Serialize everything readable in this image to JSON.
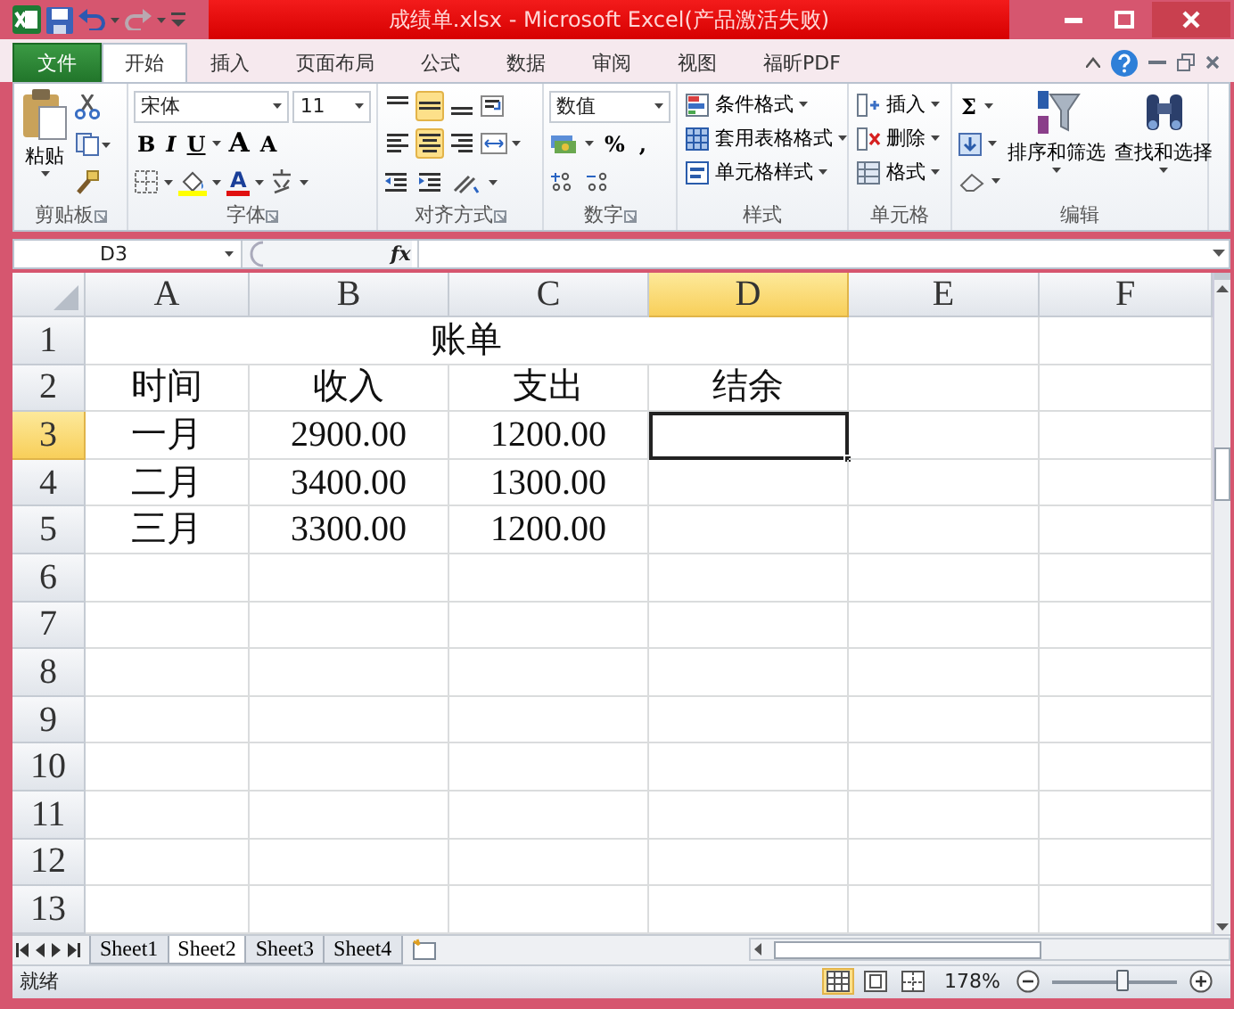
{
  "window": {
    "title": "成绩单.xlsx - Microsoft Excel(产品激活失败)"
  },
  "ribbon_tabs": [
    {
      "label": "文件",
      "kind": "file",
      "selected": false
    },
    {
      "label": "开始",
      "kind": "tab",
      "selected": true
    },
    {
      "label": "插入",
      "kind": "tab",
      "selected": false
    },
    {
      "label": "页面布局",
      "kind": "tab",
      "selected": false
    },
    {
      "label": "公式",
      "kind": "tab",
      "selected": false
    },
    {
      "label": "数据",
      "kind": "tab",
      "selected": false
    },
    {
      "label": "审阅",
      "kind": "tab",
      "selected": false
    },
    {
      "label": "视图",
      "kind": "tab",
      "selected": false
    },
    {
      "label": "福昕PDF",
      "kind": "tab",
      "selected": false
    }
  ],
  "ribbon": {
    "groups": [
      {
        "kind": "clipboard",
        "label": "剪贴板",
        "paste": "粘贴"
      },
      {
        "kind": "font",
        "label": "字体",
        "font": "宋体",
        "size": "11",
        "buttons": [
          "B",
          "I",
          "U",
          "A",
          "A"
        ],
        "font_color": "A"
      },
      {
        "kind": "alignment",
        "label": "对齐方式",
        "toggles": [
          {
            "selected": false
          },
          {
            "selected": true
          },
          {
            "selected": false
          },
          {
            "selected": false
          },
          {
            "selected": true
          },
          {
            "selected": false
          }
        ]
      },
      {
        "kind": "number",
        "label": "数字",
        "format": "数值",
        "buttons": [
          "%",
          ","
        ]
      },
      {
        "kind": "list",
        "label": "样式",
        "items": [
          "条件格式",
          "套用表格格式",
          "单元格样式"
        ]
      },
      {
        "kind": "list",
        "label": "单元格",
        "items": [
          "插入",
          "删除",
          "格式"
        ]
      },
      {
        "kind": "editing",
        "label": "编辑",
        "sum": "Σ",
        "items": [
          "排序和筛选",
          "查找和选择"
        ]
      }
    ]
  },
  "formula_bar": {
    "name_box": "D3",
    "function_label": "fx"
  },
  "sheet": {
    "columns": [
      {
        "label": "A",
        "selected": false
      },
      {
        "label": "B",
        "selected": false
      },
      {
        "label": "C",
        "selected": false
      },
      {
        "label": "D",
        "selected": true
      },
      {
        "label": "E",
        "selected": false
      },
      {
        "label": "F",
        "selected": false
      }
    ],
    "rows": [
      {
        "label": "1",
        "selected": false,
        "kind": "merged",
        "cells": [
          "账单"
        ]
      },
      {
        "label": "2",
        "selected": false,
        "kind": "plain",
        "cells": [
          "时间",
          "收入",
          "支出",
          "结余"
        ]
      },
      {
        "label": "3",
        "selected": true,
        "kind": "plain",
        "cells": [
          "一月",
          "2900.00",
          "1200.00"
        ]
      },
      {
        "label": "4",
        "selected": false,
        "kind": "plain",
        "cells": [
          "二月",
          "3400.00",
          "1300.00"
        ]
      },
      {
        "label": "5",
        "selected": false,
        "kind": "plain",
        "cells": [
          "三月",
          "3300.00",
          "1200.00"
        ]
      },
      {
        "label": "6",
        "selected": false,
        "kind": "plain"
      },
      {
        "label": "7",
        "selected": false,
        "kind": "plain"
      },
      {
        "label": "8",
        "selected": false,
        "kind": "plain"
      },
      {
        "label": "9",
        "selected": false,
        "kind": "plain"
      },
      {
        "label": "10",
        "selected": false,
        "kind": "plain"
      },
      {
        "label": "11",
        "selected": false,
        "kind": "plain"
      },
      {
        "label": "12",
        "selected": false,
        "kind": "plain"
      },
      {
        "label": "13",
        "selected": false,
        "kind": "plain"
      }
    ]
  },
  "sheet_tabs": [
    {
      "label": "Sheet1",
      "selected": false
    },
    {
      "label": "Sheet2",
      "selected": true
    },
    {
      "label": "Sheet3",
      "selected": false
    },
    {
      "label": "Sheet4",
      "selected": false
    }
  ],
  "status_bar": {
    "text": "就绪",
    "views": [
      {
        "selected": true
      },
      {
        "selected": false
      },
      {
        "selected": false
      }
    ],
    "zoom": "178%",
    "zoom_slider": {
      "level": 0.55
    }
  }
}
